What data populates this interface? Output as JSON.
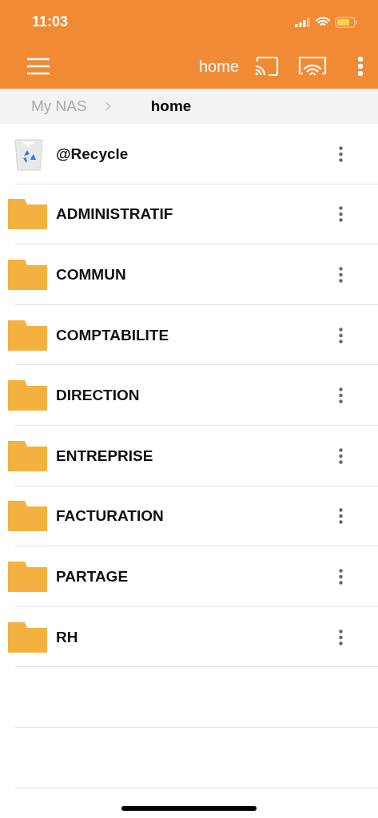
{
  "status_bar": {
    "time": "11:03"
  },
  "app_bar": {
    "title": "home"
  },
  "breadcrumb": [
    {
      "label": "My NAS",
      "selected": false
    },
    {
      "label": "home",
      "selected": true
    }
  ],
  "files": [
    {
      "name": "@Recycle",
      "kind": "recycle"
    },
    {
      "name": "ADMINISTRATIF",
      "kind": "folder"
    },
    {
      "name": "COMMUN",
      "kind": "folder"
    },
    {
      "name": "COMPTABILITE",
      "kind": "folder"
    },
    {
      "name": "DIRECTION",
      "kind": "folder"
    },
    {
      "name": "ENTREPRISE",
      "kind": "folder"
    },
    {
      "name": "FACTURATION",
      "kind": "folder"
    },
    {
      "name": "PARTAGE",
      "kind": "folder"
    },
    {
      "name": "RH",
      "kind": "folder"
    }
  ]
}
